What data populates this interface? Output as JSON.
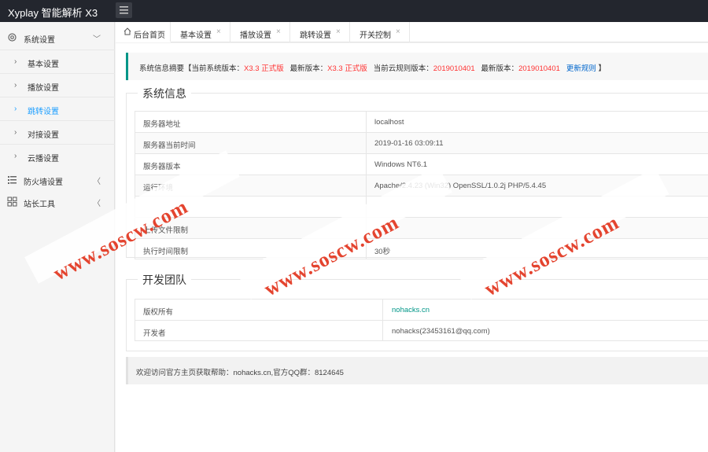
{
  "app": {
    "title": "Xyplay 智能解析 X3"
  },
  "sidebar": {
    "groups": [
      {
        "label": "系统设置",
        "icon": "gear-icon",
        "arrow": "﹀"
      },
      {
        "label": "防火墙设置",
        "icon": "list-icon",
        "arrow": "〈"
      },
      {
        "label": "站长工具",
        "icon": "grid-icon",
        "arrow": "〈"
      }
    ],
    "sub_items": [
      {
        "label": "基本设置"
      },
      {
        "label": "播放设置"
      },
      {
        "label": "跳转设置"
      },
      {
        "label": "对接设置"
      },
      {
        "label": "云播设置"
      }
    ]
  },
  "tabs": [
    {
      "label": "后台首页",
      "icon": "home-icon"
    },
    {
      "label": "基本设置"
    },
    {
      "label": "播放设置"
    },
    {
      "label": "跳转设置"
    },
    {
      "label": "开关控制"
    }
  ],
  "notice": {
    "prefix": "系统信息摘要【",
    "cur_label": "当前系统版本：",
    "cur_value": "X3.3 正式版",
    "new_label": "最新版本：",
    "new_value": "X3.3 正式版",
    "rule_label": "当前云规则版本：",
    "rule_value": "2019010401",
    "newrule_label": "最新版本：",
    "newrule_value": "2019010401",
    "update_link": "更新规则",
    "suffix": "】"
  },
  "system_info": {
    "title": "系统信息",
    "rows": [
      {
        "k": "服务器地址",
        "v": "localhost"
      },
      {
        "k": "服务器当前时间",
        "v": "2019-01-16 03:09:11"
      },
      {
        "k": "服务器版本",
        "v": "Windows NT6.1"
      },
      {
        "k": "运行环境",
        "v": "Apache/2.4.23 (Win32) OpenSSL/1.0.2j PHP/5.4.45"
      },
      {
        "k": "",
        "v": ""
      },
      {
        "k": "上传文件限制",
        "v": ""
      },
      {
        "k": "执行时间限制",
        "v": "30秒"
      }
    ]
  },
  "team": {
    "title": "开发团队",
    "rows": [
      {
        "k": "版权所有",
        "v": "nohacks.cn"
      },
      {
        "k": "开发者",
        "v": "nohacks(23453161@qq.com)"
      }
    ]
  },
  "footer": {
    "text": "欢迎访问官方主页获取帮助：nohacks.cn,官方QQ群：8124645"
  },
  "watermark": {
    "text": "www.soscw.com"
  },
  "colors": {
    "topbar": "#23262e",
    "accent": "#009688",
    "active": "#1e9fff",
    "red": "#ff3333",
    "watermark": "#e4442f"
  }
}
